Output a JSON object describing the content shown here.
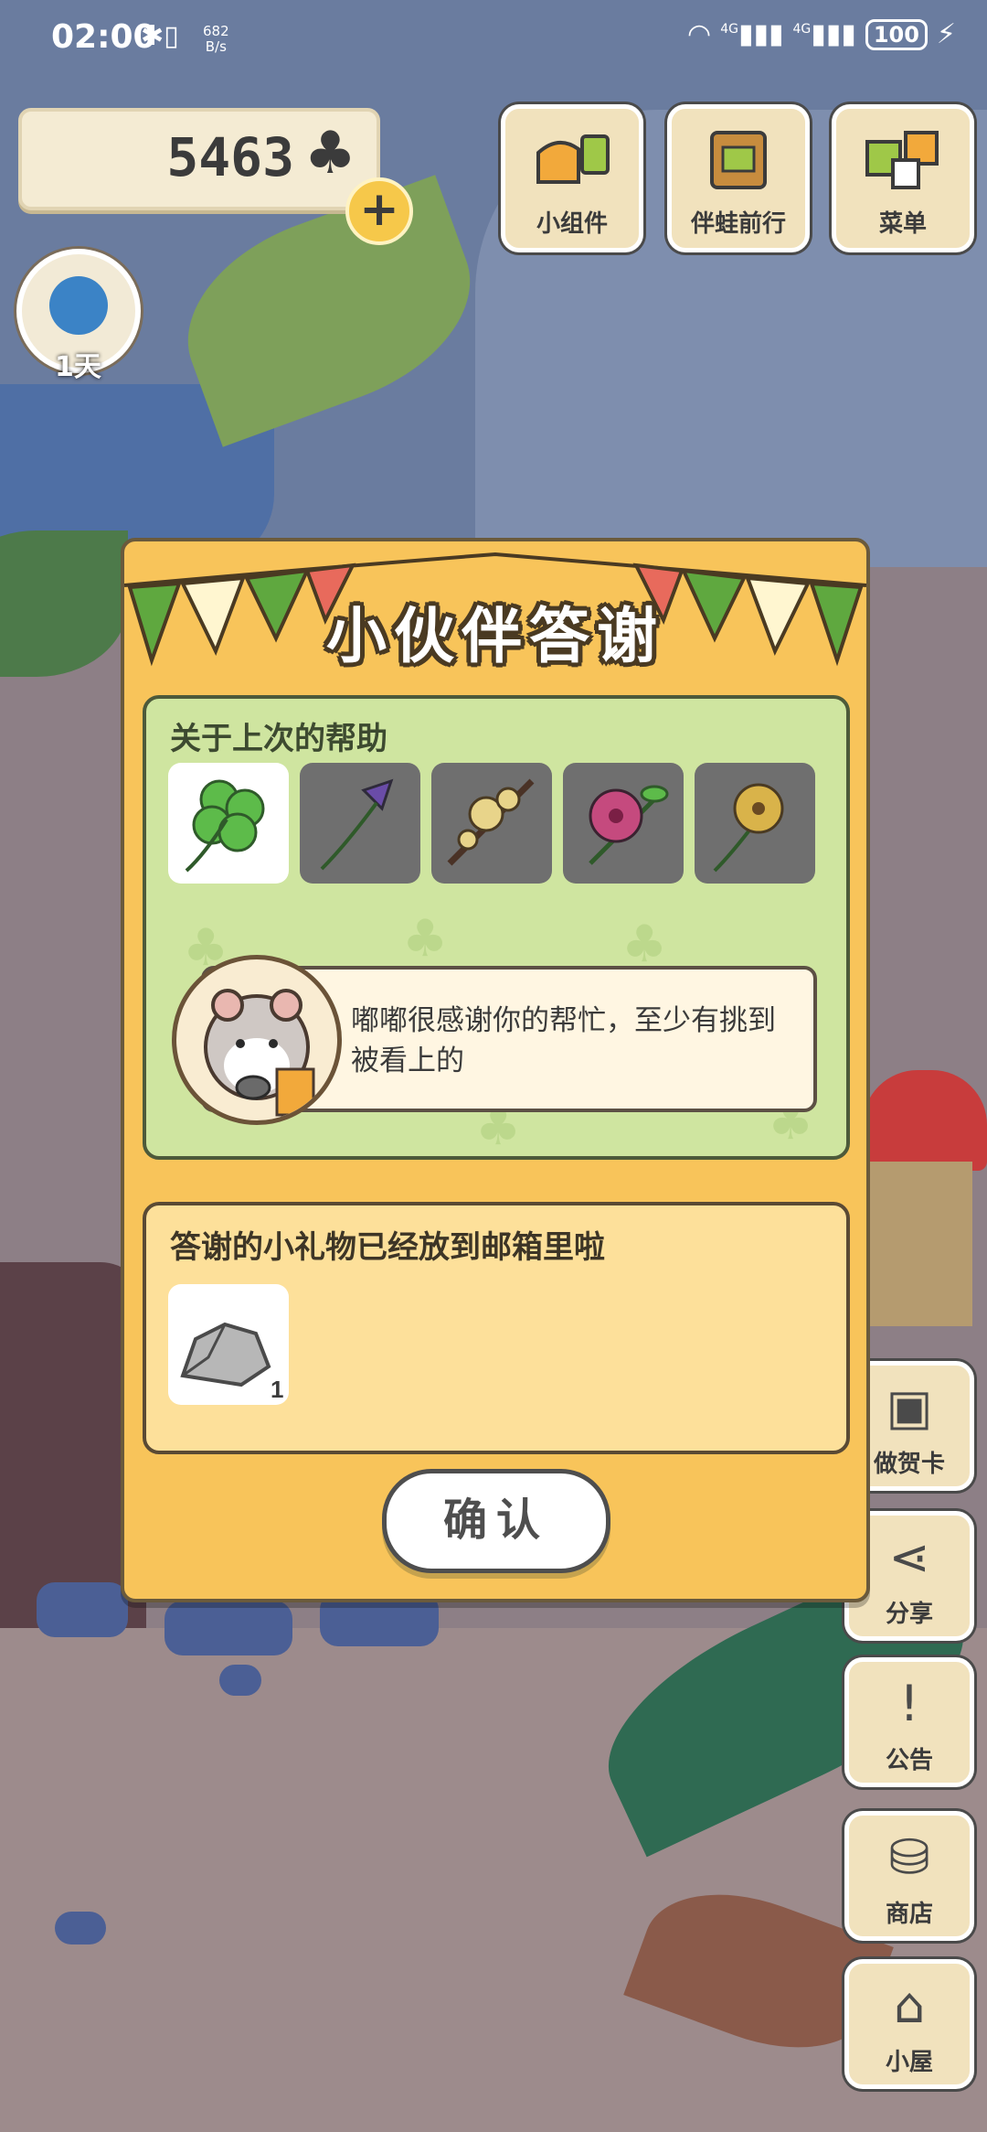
{
  "status_bar": {
    "time": "02:00",
    "net_speed_value": "682",
    "net_speed_unit": "B/s",
    "net_type_1": "4G",
    "net_type_2": "4G",
    "battery": "100"
  },
  "hud": {
    "clover_count": "5463",
    "add_label": "+",
    "day_label": "1天"
  },
  "top_buttons": [
    {
      "label": "小组件",
      "icon": "widget-icon"
    },
    {
      "label": "伴蛙前行",
      "icon": "album-icon"
    },
    {
      "label": "菜单",
      "icon": "menu-icon"
    }
  ],
  "side_buttons": [
    {
      "label": "做贺卡",
      "icon": "card-icon"
    },
    {
      "label": "分享",
      "icon": "share-icon"
    },
    {
      "label": "公告",
      "icon": "notice-icon"
    },
    {
      "label": "商店",
      "icon": "shop-icon"
    },
    {
      "label": "小屋",
      "icon": "house-icon"
    }
  ],
  "dialog": {
    "title": "小伙伴答谢",
    "help_heading": "关于上次的帮助",
    "flowers": [
      {
        "icon": "four-leaf-clover-icon",
        "selected": true
      },
      {
        "icon": "bellflower-icon",
        "selected": false
      },
      {
        "icon": "plum-blossom-icon",
        "selected": false
      },
      {
        "icon": "hibiscus-icon",
        "selected": false
      },
      {
        "icon": "buttercup-icon",
        "selected": false
      }
    ],
    "message": "嘟嘟很感谢你的帮忙，至少有挑到被看上的",
    "gift_heading": "答谢的小礼物已经放到邮箱里啦",
    "gift_item": {
      "icon": "stone-icon",
      "count": "1"
    },
    "confirm_label": "确认"
  },
  "colors": {
    "dialog_bg": "#f8c45a",
    "help_panel_bg": "#cfe5a0",
    "gift_panel_bg": "#fde09a",
    "flag_green": "#5fa83f",
    "flag_red": "#e86a5c"
  }
}
